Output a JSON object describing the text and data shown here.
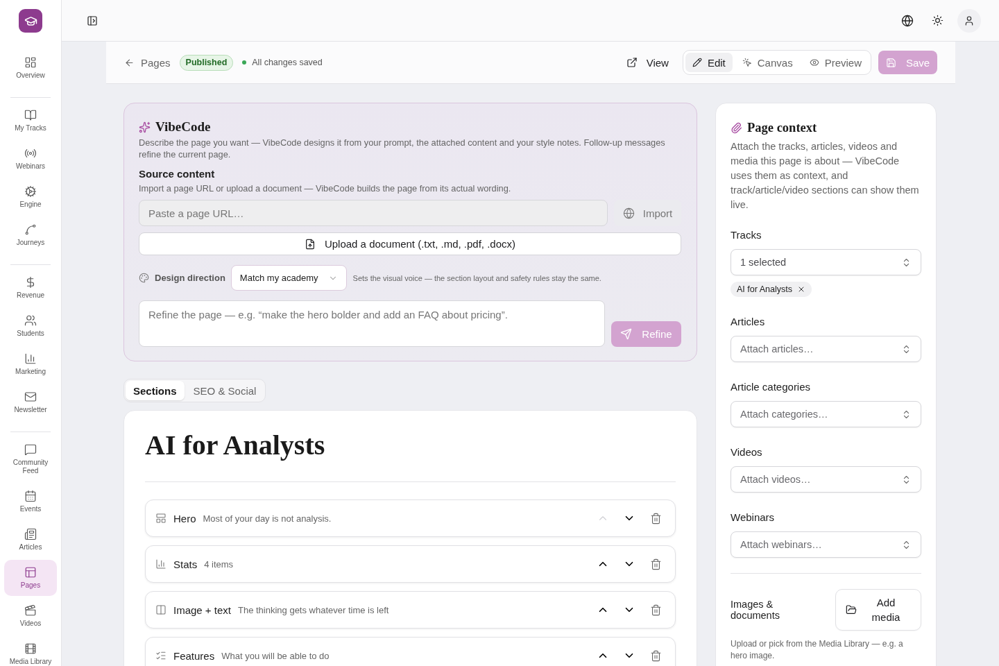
{
  "sidebar": {
    "groups": [
      {
        "items": [
          {
            "label": "Overview",
            "selected": false
          }
        ]
      },
      {
        "items": [
          {
            "label": "My Tracks",
            "selected": false
          },
          {
            "label": "Webinars",
            "selected": false
          },
          {
            "label": "Engine",
            "selected": false
          },
          {
            "label": "Journeys",
            "selected": false
          }
        ]
      },
      {
        "items": [
          {
            "label": "Revenue",
            "selected": false
          },
          {
            "label": "Students",
            "selected": false
          },
          {
            "label": "Marketing",
            "selected": false
          },
          {
            "label": "Newsletter",
            "selected": false
          }
        ]
      },
      {
        "items": [
          {
            "label": "Community Feed",
            "selected": false
          },
          {
            "label": "Events",
            "selected": false
          },
          {
            "label": "Articles",
            "selected": false
          },
          {
            "label": "Pages",
            "selected": true
          },
          {
            "label": "Videos",
            "selected": false
          },
          {
            "label": "Media Library",
            "selected": false
          }
        ]
      }
    ]
  },
  "toolbar": {
    "back": "Pages",
    "status": "Published",
    "save_state": "All changes saved",
    "view": "View",
    "modes": [
      {
        "label": "Edit",
        "selected": true
      },
      {
        "label": "Canvas",
        "selected": false
      },
      {
        "label": "Preview",
        "selected": false
      }
    ],
    "save": {
      "label": "Save",
      "disabled": true
    }
  },
  "vibecode": {
    "title": "VibeCode",
    "description": "Describe the page you want — VibeCode designs it from your prompt, the attached content and your style notes. Follow-up messages refine the current page.",
    "source": {
      "title": "Source content",
      "description": "Import a page URL or upload a document — VibeCode builds the page from its actual wording.",
      "url": {
        "placeholder": "Paste a page URL…"
      },
      "import": "Import",
      "upload": "Upload a document (.txt, .md, .pdf, .docx)"
    },
    "design": {
      "label": "Design direction",
      "value": "Match my academy",
      "hint": "Sets the visual voice — the section layout and safety rules stay the same."
    },
    "prompt": {
      "placeholder": "Refine the page — e.g. “make the hero bolder and add an FAQ about pricing”."
    },
    "refine": {
      "label": "Refine",
      "disabled": true
    }
  },
  "tabs": [
    {
      "label": "Sections",
      "selected": true
    },
    {
      "label": "SEO & Social",
      "selected": false
    }
  ],
  "page": {
    "title": "AI for Analysts",
    "sections": [
      {
        "kind": "hero",
        "name": "Hero",
        "summary": "Most of your day is not analysis.",
        "up_disabled": true
      },
      {
        "kind": "stats",
        "name": "Stats",
        "summary": "4 items",
        "up_disabled": false
      },
      {
        "kind": "image_text",
        "name": "Image + text",
        "summary": "The thinking gets whatever time is left",
        "up_disabled": false
      },
      {
        "kind": "features",
        "name": "Features",
        "summary": "What you will be able to do",
        "up_disabled": false
      }
    ]
  },
  "context": {
    "title": "Page context",
    "description": "Attach the tracks, articles, videos and media this page is about — VibeCode uses them as context, and track/article/video sections can show them live.",
    "fields": [
      {
        "label": "Tracks",
        "value": "1 selected",
        "chips": [
          "AI for Analysts"
        ]
      },
      {
        "label": "Articles",
        "placeholder": "Attach articles…"
      },
      {
        "label": "Article categories",
        "placeholder": "Attach categories…"
      },
      {
        "label": "Videos",
        "placeholder": "Attach videos…"
      },
      {
        "label": "Webinars",
        "placeholder": "Attach webinars…"
      }
    ],
    "media": {
      "label": "Images & documents",
      "button": "Add media",
      "note": "Upload or pick from the Media Library — e.g. a hero image."
    }
  }
}
